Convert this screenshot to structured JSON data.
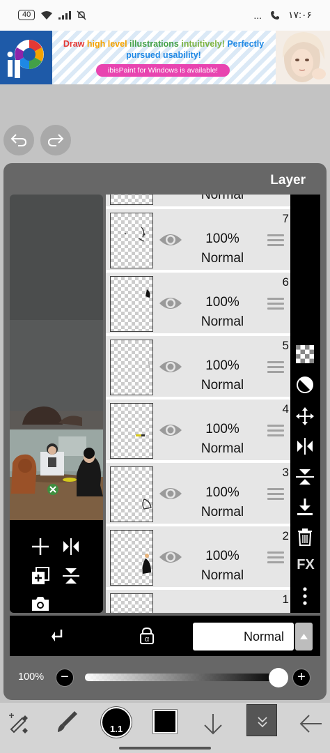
{
  "status_bar": {
    "battery": "40",
    "time": "۱۷:۰۶",
    "dots": "..."
  },
  "ad": {
    "headline_words": [
      {
        "text": "Draw ",
        "color": "#e53935"
      },
      {
        "text": "high level ",
        "color": "#f5a300"
      },
      {
        "text": "illustrations ",
        "color": "#43a047"
      },
      {
        "text": "intuitively! ",
        "color": "#7cb342"
      },
      {
        "text": "Perfectly ",
        "color": "#1e88e5"
      },
      {
        "text": "pursued usability!",
        "color": "#1e88e5"
      }
    ],
    "badge": "ibisPaint for Windows is available!"
  },
  "panel": {
    "title": "Layer"
  },
  "layers": [
    {
      "number": "",
      "opacity": "",
      "mode": "Normal"
    },
    {
      "number": "7",
      "opacity": "100%",
      "mode": "Normal"
    },
    {
      "number": "6",
      "opacity": "100%",
      "mode": "Normal"
    },
    {
      "number": "5",
      "opacity": "100%",
      "mode": "Normal"
    },
    {
      "number": "4",
      "opacity": "100%",
      "mode": "Normal"
    },
    {
      "number": "3",
      "opacity": "100%",
      "mode": "Normal"
    },
    {
      "number": "2",
      "opacity": "100%",
      "mode": "Normal"
    },
    {
      "number": "1",
      "opacity": "",
      "mode": ""
    }
  ],
  "right_tools": {
    "fx_label": "FX"
  },
  "blend": {
    "mode_value": "Normal"
  },
  "opacity": {
    "label": "100%",
    "value": 1.0
  },
  "bottom_toolbar": {
    "brush_size": "1.1"
  },
  "colors": {
    "panel": "#676767",
    "current_color": "#000000",
    "accent_pink": "#e844b0"
  }
}
